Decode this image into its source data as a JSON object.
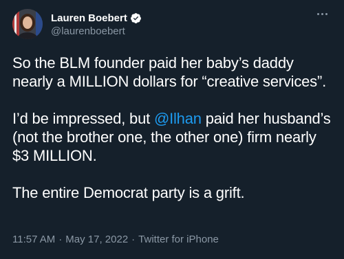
{
  "author": {
    "display_name": "Lauren Boebert",
    "handle": "@laurenboebert",
    "verified_icon": "verified-badge-icon",
    "avatar_icon": "profile-avatar"
  },
  "more_icon": "more-options-icon",
  "tweet": {
    "p1": "So the BLM founder paid her baby’s daddy nearly a MILLION dollars for “creative services”.",
    "p2_before": "I’d be impressed, but ",
    "p2_mention": "@Ilhan",
    "p2_after": " paid her husband’s (not the brother one, the other one) firm nearly $3 MILLION.",
    "p3": "The entire Democrat party is a grift."
  },
  "meta": {
    "time": "11:57 AM",
    "sep1": "·",
    "date": "May 17, 2022",
    "sep2": "·",
    "source": "Twitter for iPhone"
  },
  "colors": {
    "background": "#15202b",
    "text": "#ffffff",
    "secondary": "#8b98a5",
    "accent": "#1d9bf0"
  }
}
